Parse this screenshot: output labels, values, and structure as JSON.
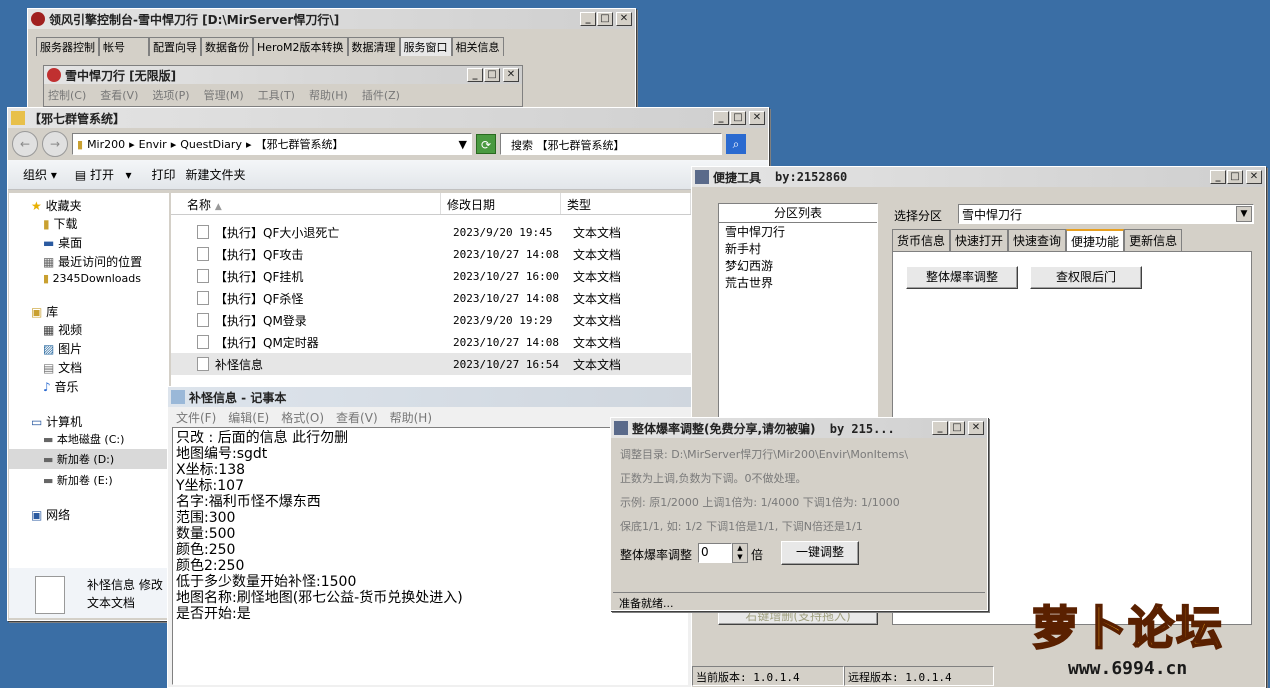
{
  "console": {
    "title": "领风引擎控制台-雪中悍刀行 [D:\\MirServer悍刀行\\]",
    "tabs": [
      "服务器控制",
      "帐号",
      "配置向导",
      "数据备份",
      "HeroM2版本转换",
      "数据清理",
      "服务窗口",
      "相关信息"
    ],
    "inner_title": "雪中悍刀行 [无限版]",
    "inner_menu": [
      "控制(C)",
      "查看(V)",
      "选项(P)",
      "管理(M)",
      "工具(T)",
      "帮助(H)",
      "插件(Z)"
    ]
  },
  "explorer": {
    "title": "【邪七群管系统】",
    "address": [
      "Mir200",
      "Envir",
      "QuestDiary",
      "【邪七群管系统】"
    ],
    "search_placeholder": "搜索 【邪七群管系统】",
    "toolbar": {
      "organize": "组织",
      "open": "打开",
      "print": "打印",
      "new_folder": "新建文件夹"
    },
    "nav": {
      "favorites": "收藏夹",
      "fav_items": [
        "下载",
        "桌面",
        "最近访问的位置",
        "2345Downloads"
      ],
      "libraries": "库",
      "lib_items": [
        "视频",
        "图片",
        "文档",
        "音乐"
      ],
      "computer": "计算机",
      "drives": [
        "本地磁盘 (C:)",
        "新加卷 (D:)",
        "新加卷 (E:)"
      ],
      "network": "网络"
    },
    "columns": [
      "名称",
      "修改日期",
      "类型"
    ],
    "files": [
      {
        "name": "【执行】QF大小退死亡",
        "date": "2023/9/20 19:45",
        "type": "文本文档"
      },
      {
        "name": "【执行】QF攻击",
        "date": "2023/10/27 14:08",
        "type": "文本文档"
      },
      {
        "name": "【执行】QF挂机",
        "date": "2023/10/27 16:00",
        "type": "文本文档"
      },
      {
        "name": "【执行】QF杀怪",
        "date": "2023/10/27 14:08",
        "type": "文本文档"
      },
      {
        "name": "【执行】QM登录",
        "date": "2023/9/20 19:29",
        "type": "文本文档"
      },
      {
        "name": "【执行】QM定时器",
        "date": "2023/10/27 14:08",
        "type": "文本文档"
      },
      {
        "name": "补怪信息",
        "date": "2023/10/27 16:54",
        "type": "文本文档"
      }
    ],
    "details": {
      "name": "补怪信息",
      "meta": "修改",
      "type": "文本文档"
    }
  },
  "notepad": {
    "title": "补怪信息 - 记事本",
    "menu": [
      "文件(F)",
      "编辑(E)",
      "格式(O)",
      "查看(V)",
      "帮助(H)"
    ],
    "lines": [
      "只改 : 后面的信息 此行勿删",
      "地图编号:sgdt",
      "X坐标:138",
      "Y坐标:107",
      "名字:福利币怪不爆东西",
      "范围:300",
      "数量:500",
      "颜色:250",
      "颜色2:250",
      "低于多少数量开始补怪:1500",
      "地图名称:刷怪地图(邪七公益-货币兑换处进入)",
      "是否开始:是"
    ]
  },
  "tool": {
    "title": "便捷工具",
    "by": "by:2152860",
    "zone_list_title": "分区列表",
    "zones": [
      "雪中悍刀行",
      "新手村",
      "梦幻西游",
      "荒古世界"
    ],
    "select_label": "选择分区",
    "select_value": "雪中悍刀行",
    "tabs": [
      "货币信息",
      "快速打开",
      "快速查询",
      "便捷功能",
      "更新信息"
    ],
    "buttons": [
      "整体爆率调整",
      "查权限后门"
    ],
    "bottom_btn": "右键增删(支持拖入)",
    "cur_ver": "当前版本: 1.0.1.4",
    "remote_ver": "远程版本: 1.0.1.4"
  },
  "dialog": {
    "title": "整体爆率调整(免费分享,请勿被骗)",
    "by": "by 215...",
    "dir": "调整目录: D:\\MirServer悍刀行\\Mir200\\Envir\\MonItems\\",
    "line2": "正数为上调,负数为下调。0不做处理。",
    "line3": "示例: 原1/2000 上调1倍为: 1/4000 下调1倍为: 1/1000",
    "line4": "保底1/1, 如: 1/2 下调1倍是1/1, 下调N倍还是1/1",
    "adj_label": "整体爆率调整",
    "adj_value": "0",
    "unit": "倍",
    "apply": "一键调整",
    "status": "准备就绪..."
  },
  "watermark": {
    "text": "萝卜论坛",
    "url": "www.6994.cn"
  }
}
